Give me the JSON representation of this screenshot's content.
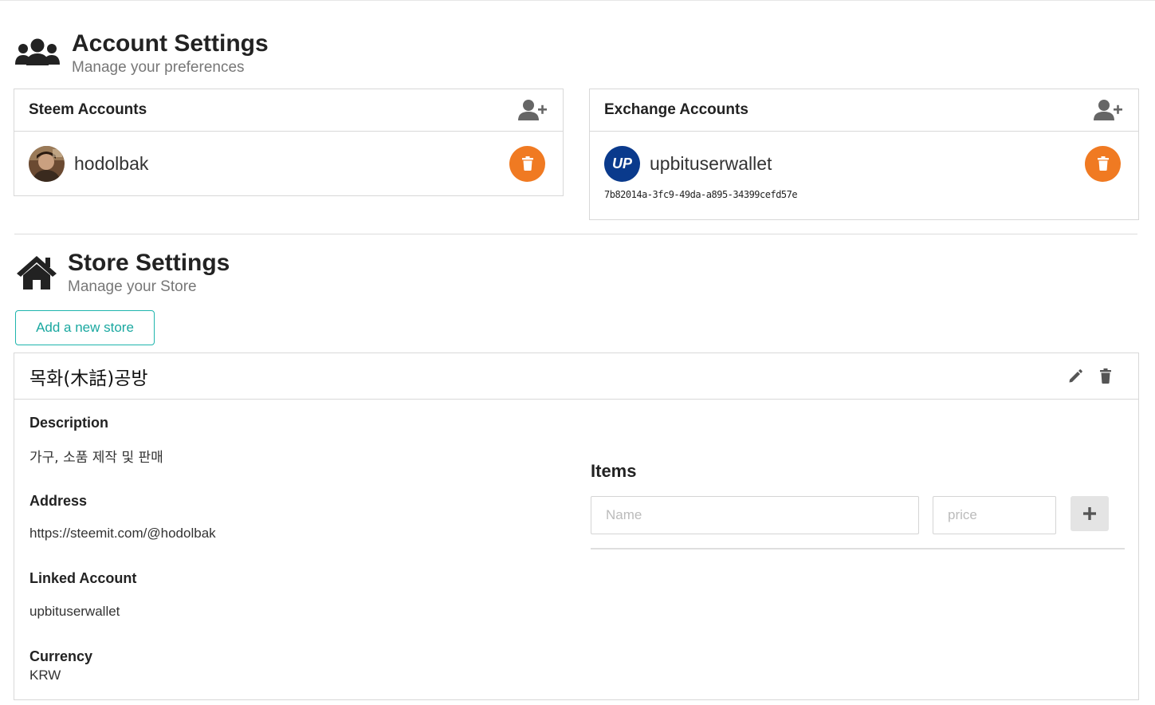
{
  "account_section": {
    "title": "Account Settings",
    "subtitle": "Manage your preferences"
  },
  "steem_panel": {
    "title": "Steem Accounts",
    "accounts": [
      {
        "name": "hodolbak"
      }
    ]
  },
  "exchange_panel": {
    "title": "Exchange Accounts",
    "accounts": [
      {
        "logo_text": "UP",
        "name": "upbituserwallet",
        "key": "7b82014a-3fc9-49da-a895-34399cefd57e"
      }
    ]
  },
  "store_section": {
    "title": "Store Settings",
    "subtitle": "Manage your Store",
    "add_button": "Add a new store"
  },
  "store": {
    "name": "목화(木話)공방",
    "description_label": "Description",
    "description": "가구, 소품 제작 및 판매",
    "address_label": "Address",
    "address": "https://steemit.com/@hodolbak",
    "linked_label": "Linked Account",
    "linked_account": "upbituserwallet",
    "currency_label": "Currency",
    "currency": "KRW",
    "items_title": "Items",
    "name_placeholder": "Name",
    "price_placeholder": "price"
  },
  "colors": {
    "accent_teal": "#1fb5ad",
    "delete_orange": "#f07a22",
    "upbit_blue": "#0a3a8c"
  }
}
